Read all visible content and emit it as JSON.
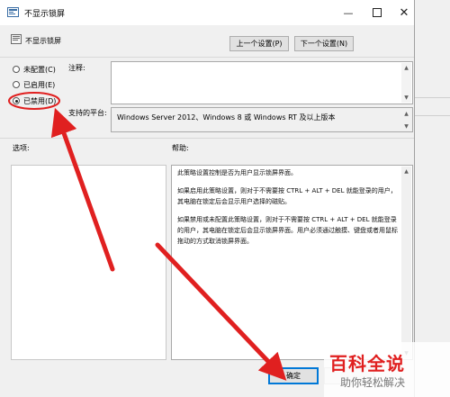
{
  "window": {
    "title": "不显示锁屏"
  },
  "header": {
    "policy_name": "不显示锁屏",
    "prev_button": "上一个设置(P)",
    "next_button": "下一个设置(N)"
  },
  "options": [
    {
      "label": "未配置(C)",
      "checked": false
    },
    {
      "label": "已启用(E)",
      "checked": false
    },
    {
      "label": "已禁用(D)",
      "checked": true
    }
  ],
  "comment": {
    "label": "注释:"
  },
  "platform": {
    "label": "支持的平台:",
    "value": "Windows Server 2012、Windows 8 或 Windows RT 及以上版本"
  },
  "sections": {
    "options_label": "选项:",
    "help_label": "帮助:"
  },
  "help": {
    "p1": "此策略设置控制是否为用户显示锁屏界面。",
    "p2": "如果启用此策略设置，则对于不需要按 CTRL + ALT + DEL 就能登录的用户，其电脑在锁定后会显示用户选择的磁贴。",
    "p3": "如果禁用或未配置此策略设置，则对于不需要按 CTRL + ALT + DEL 就能登录的用户，其电脑在锁定后会显示锁屏界面。用户必须通过触摸、键盘或者用鼠标拖动的方式取消锁屏界面。"
  },
  "footer": {
    "ok_button": "确定"
  },
  "watermark": {
    "line1": "百科全说",
    "line2": "助你轻松解决"
  },
  "colors": {
    "arrow": "#e02020",
    "ok_border": "#0078d7",
    "watermark_red": "#e02020"
  }
}
